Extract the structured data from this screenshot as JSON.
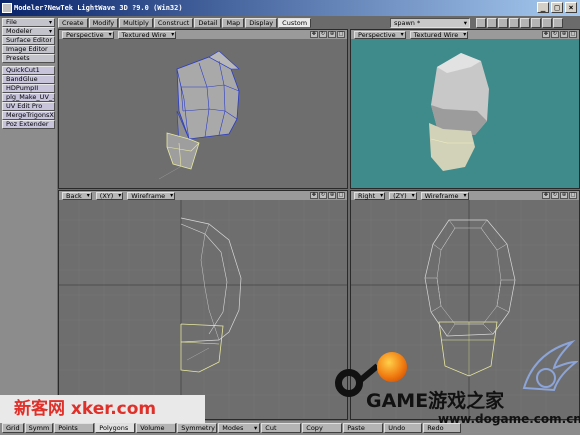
{
  "window": {
    "title": "Modeler?NewTek LightWave 3D ?9.0 (Win32)",
    "min": "_",
    "max": "□",
    "close": "×"
  },
  "sidebar": {
    "file": "File",
    "modeler": "Modeler",
    "items": [
      "Surface Editor",
      "Image Editor",
      "Presets"
    ],
    "plugins": [
      "QuickCut1",
      "BandGlue",
      "HDPumpII",
      "plg_Make_UV_...",
      "UV Edit Pro",
      "MergeTrigonsX",
      "Poz Extender"
    ]
  },
  "tabs": [
    "Create",
    "Modify",
    "Multiply",
    "Construct",
    "Detail",
    "Map",
    "Display",
    "Custom"
  ],
  "active_tab": "Custom",
  "spawn": "spawn *",
  "viewports": [
    {
      "view": "Perspective",
      "mode": "Textured Wire"
    },
    {
      "view": "Perspective",
      "mode": "Textured Wire"
    },
    {
      "view": "Back",
      "axis": "(XY)",
      "mode": "Wireframe"
    },
    {
      "view": "Right",
      "axis": "(ZY)",
      "mode": "Wireframe"
    }
  ],
  "bottom": {
    "buttons": [
      "Grid",
      "Symm",
      "Points",
      "Polygons",
      "Volume",
      "Symmetry",
      "Modes",
      "Cut",
      "Copy",
      "Paste",
      "Undo",
      "Redo"
    ],
    "active": "Polygons"
  },
  "watermarks": {
    "left": "新客网 xker.com",
    "game": "GAME游戏之家",
    "url": "www.dogame.com.cn"
  },
  "colors": {
    "accent_teal": "#3f8a8a",
    "viewport_gray": "#6e6e6e",
    "wire_blue": "#2a3cc8",
    "wire_yellow": "#e8e8a0"
  }
}
